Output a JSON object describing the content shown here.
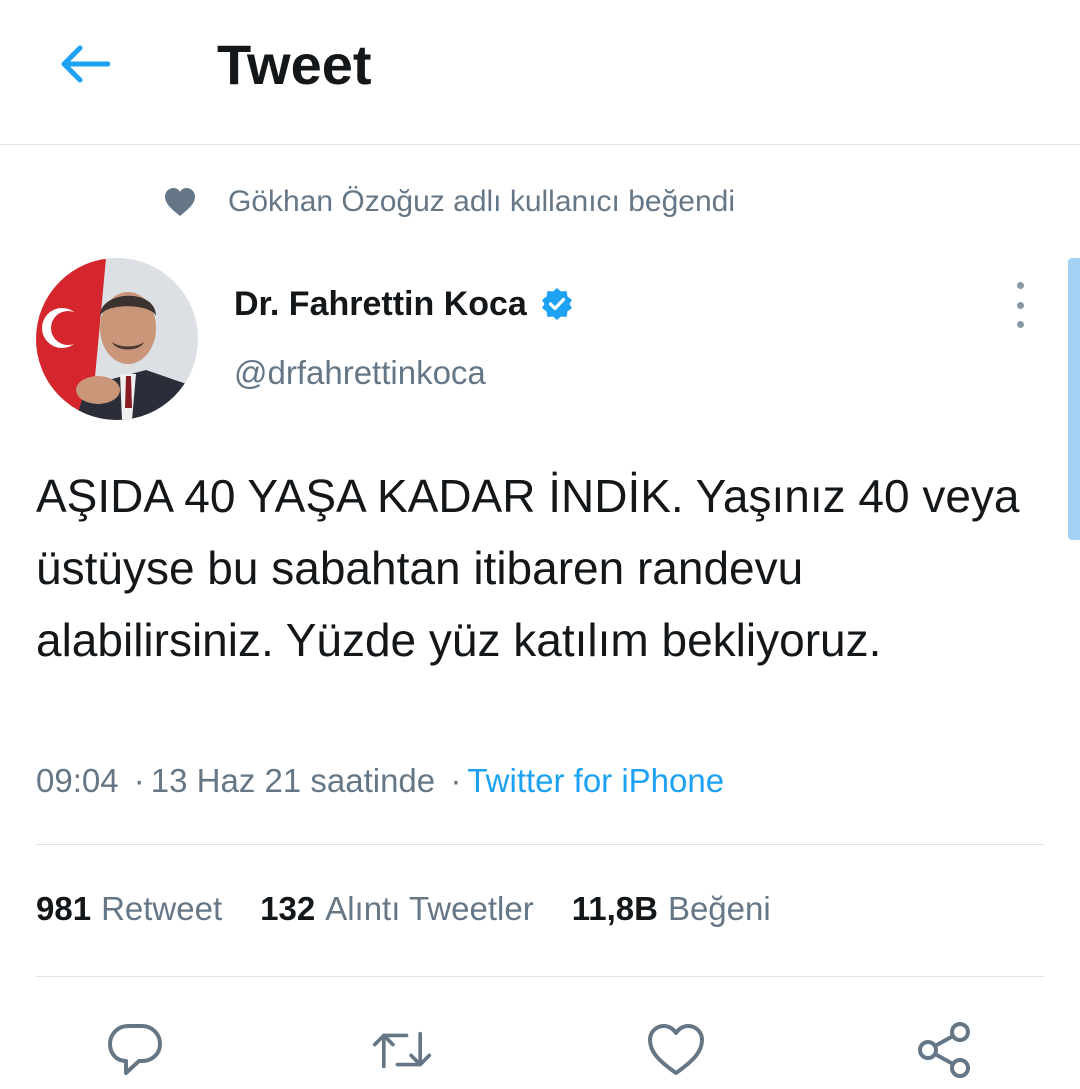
{
  "header": {
    "title": "Tweet",
    "back_icon": "arrow-left-icon"
  },
  "colors": {
    "accent": "#1da1f2",
    "text_primary": "#14171a",
    "text_secondary": "#657786",
    "divider": "#dfe3e7"
  },
  "social_context": {
    "icon": "heart-icon",
    "text": "Gökhan Özoğuz adlı kullanıcı beğendi"
  },
  "author": {
    "name": "Dr. Fahrettin Koca",
    "handle": "@drfahrettinkoca",
    "verified": true
  },
  "tweet": {
    "text": "AŞIDA 40 YAŞA KADAR İNDİK. Yaşınız 40 veya üstüyse bu sabahtan itibaren randevu alabilirsiniz. Yüzde yüz katılım bekliyoruz.",
    "time": "09:04",
    "date": "13 Haz 21 saatinde",
    "separator": "·",
    "source": "Twitter for iPhone"
  },
  "stats": {
    "retweets": {
      "count": "981",
      "label": "Retweet"
    },
    "quotes": {
      "count": "132",
      "label": "Alıntı Tweetler"
    },
    "likes": {
      "count": "11,8B",
      "label": "Beğeni"
    }
  },
  "actions": [
    "reply-icon",
    "retweet-icon",
    "like-icon",
    "share-icon"
  ]
}
